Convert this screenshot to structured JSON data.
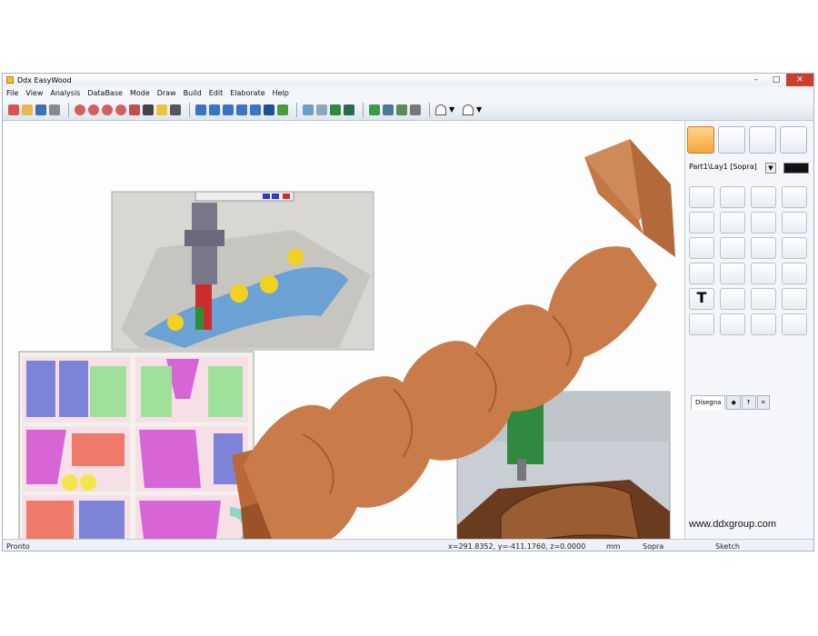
{
  "window": {
    "title": "Ddx EasyWood",
    "controls": {
      "minimize": "–",
      "maximize": "□",
      "close": "✕"
    }
  },
  "menu": [
    "File",
    "View",
    "Analysis",
    "DataBase",
    "Mode",
    "Draw",
    "Build",
    "Edit",
    "Elaborate",
    "Help"
  ],
  "right_panel": {
    "layer_select": "Part1\\Lay1 [Sopra]",
    "tabs": {
      "disegna": "Disegna"
    }
  },
  "status": {
    "left": "Pronto",
    "coords": "x=291.8352, y=-411.1760, z=0.0000",
    "unit": "mm",
    "view": "Sopra",
    "mode": "Sketch"
  },
  "website": "www.ddxgroup.com",
  "colors": {
    "wood": "#c97c4a",
    "accent": "#f4a63b",
    "title_bg": "#e9eef6",
    "close": "#c9402f"
  }
}
